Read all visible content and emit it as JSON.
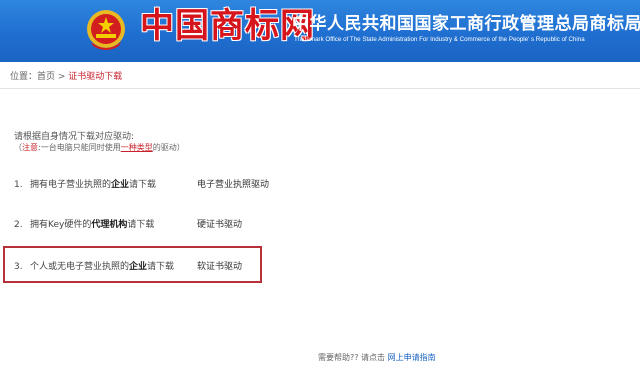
{
  "header": {
    "logo_text": "中国商标网",
    "office_cn": "中华人民共和国国家工商行政管理总局商标局",
    "office_en": "Trademark Office of The State Administration For Industry & Commerce of the People' s Republic of China"
  },
  "breadcrumb": {
    "prefix": "位置：",
    "home": "首页",
    "separator": " > ",
    "current": "证书驱动下载"
  },
  "intro": "请根据自身情况下载对应驱动:",
  "note": {
    "open": "（",
    "label": "注意",
    "text_a": ":一台电脑只能同时使用",
    "underlined": "一种类型",
    "text_b": "的驱动）"
  },
  "items": [
    {
      "num": "1.",
      "pre": "拥有电子营业执照的",
      "bold": "企业",
      "post": "请下载",
      "driver": "电子营业执照驱动"
    },
    {
      "num": "2.",
      "pre": "拥有Key硬件的",
      "bold": "代理机构",
      "post": "请下载",
      "driver": "硬证书驱动"
    },
    {
      "num": "3.",
      "pre": "个人或无电子营业执照的",
      "bold": "企业",
      "post": "请下载",
      "driver": "软证书驱动"
    }
  ],
  "footer": {
    "text": "需要帮助?? 请点击 ",
    "link": "网上申请指南"
  },
  "colors": {
    "header_bg": "#1f6fd0",
    "logo_red": "#d6141b",
    "highlight_border": "#b7313b"
  }
}
